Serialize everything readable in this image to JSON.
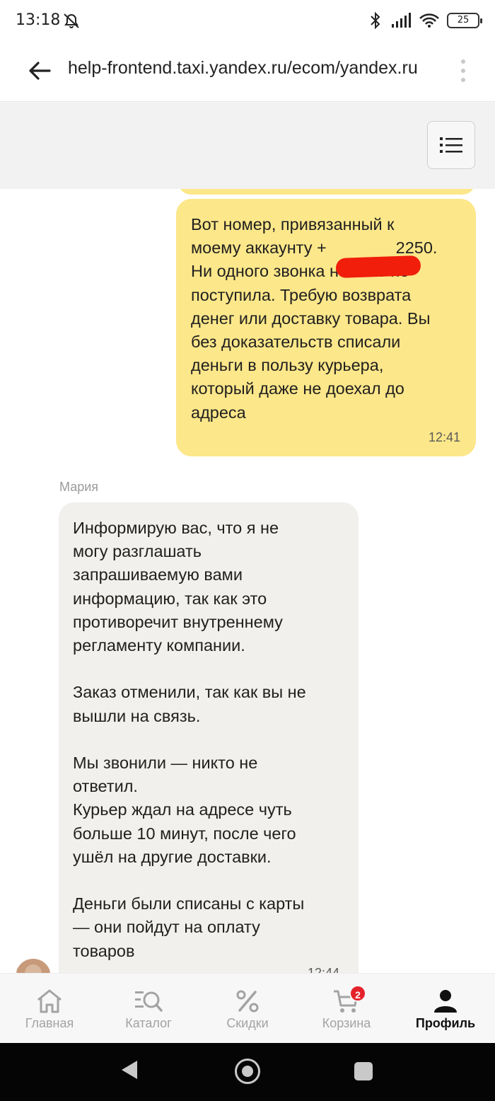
{
  "status_bar": {
    "time": "13:18",
    "battery": "25"
  },
  "browser": {
    "url": "help-frontend.taxi.yandex.ru/ecom/yandex.ru"
  },
  "chat": {
    "user_message": {
      "text": "Вот номер, привязанный к\nмоему аккаунту +               2250.\nНи одного звонка на него не\nпоступила. Требую возврата\nденег или доставку товара. Вы\nбез доказательств списали\nденьги в пользу курьера,\nкоторый даже не доехал до\nадреса",
      "time": "12:41"
    },
    "agent_message": {
      "sender": "Мария",
      "text": "Информирую вас, что я не\nмогу разглашать\nзапрашиваемую вами\nинформацию, так как это\nпротиворечит внутреннему\nрегламенту компании.\n\nЗаказ отменили, так как вы не\nвышли на связь.\n\nМы звонили — никто не\nответил.\nКурьер ждал на адресе чуть\nбольше 10 минут, после чего\nушёл на другие доставки.\n\nДеньги были списаны с карты\n— они пойдут на оплату\nтоваров",
      "time": "12:44"
    }
  },
  "tab_bar": {
    "tabs": [
      {
        "label": "Главная",
        "icon": "home-icon"
      },
      {
        "label": "Каталог",
        "icon": "catalog-icon"
      },
      {
        "label": "Скидки",
        "icon": "percent-icon"
      },
      {
        "label": "Корзина",
        "icon": "cart-icon"
      },
      {
        "label": "Профиль",
        "icon": "profile-icon"
      }
    ],
    "active": "Профиль",
    "cart_badge": "2",
    "colors": {
      "active": "#111111",
      "inactive": "#a3a3a3",
      "badge": "#e5222b"
    }
  },
  "colors": {
    "user_bubble": "#fce78a",
    "agent_bubble": "#f1f0ed"
  }
}
